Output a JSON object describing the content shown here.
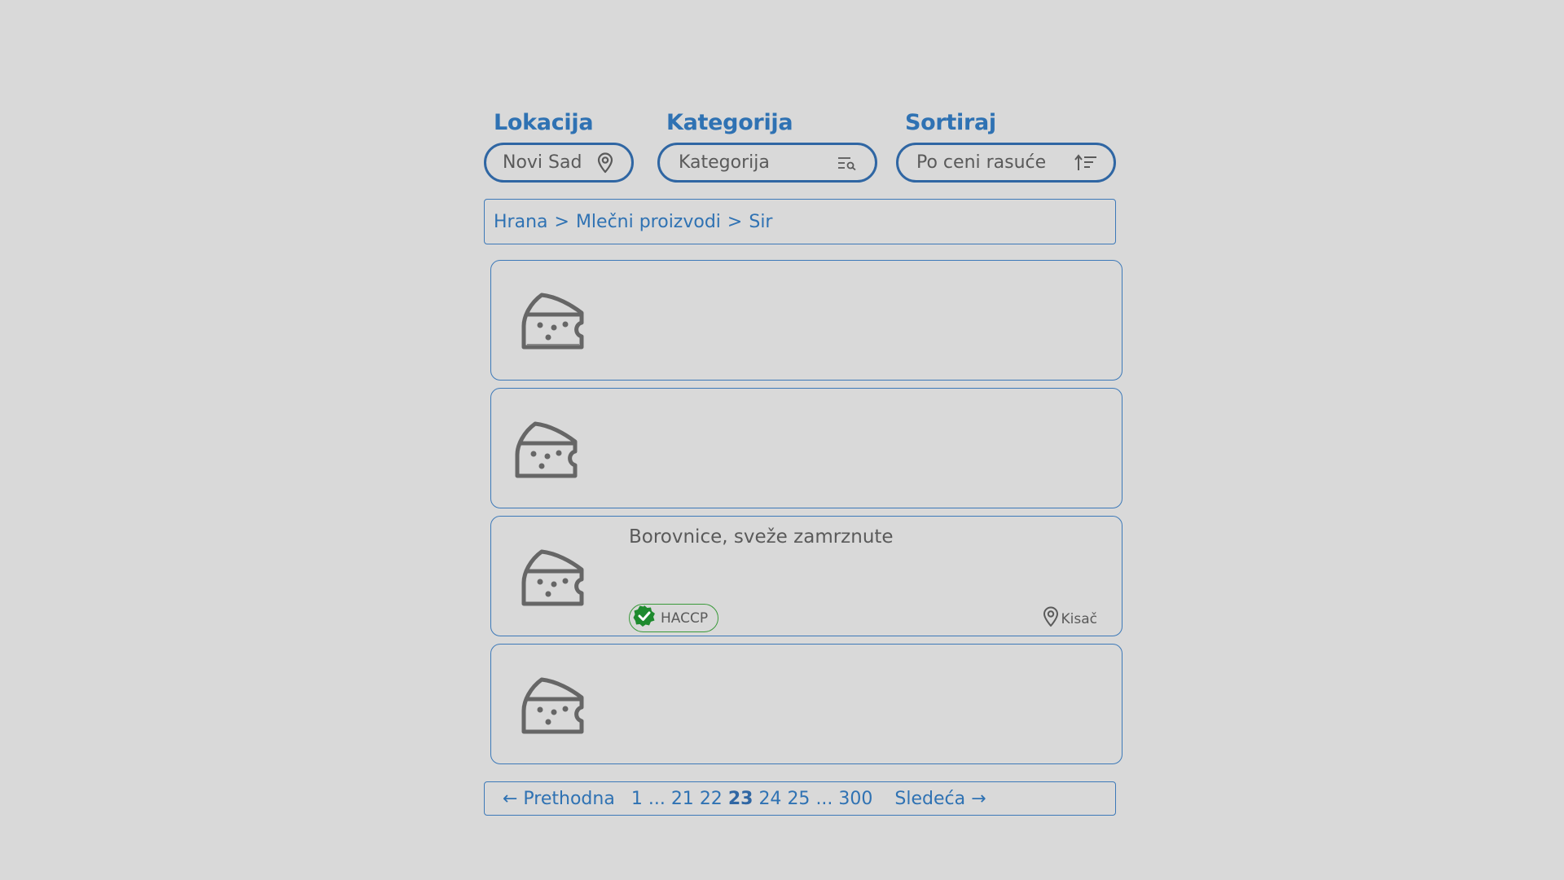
{
  "filters": {
    "location": {
      "label": "Lokacija",
      "value": "Novi Sad",
      "icon": "map-pin-icon"
    },
    "category": {
      "label": "Kategorija",
      "placeholder": "Kategorija",
      "icon": "search-list-icon"
    },
    "sort": {
      "label": "Sortiraj",
      "value": "Po ceni rasuće",
      "icon": "sort-ascending-icon"
    }
  },
  "breadcrumb": {
    "items": [
      "Hrana",
      "Mlečni proizvodi",
      "Sir"
    ],
    "separator": ">"
  },
  "listings": [
    {
      "icon": "cheese-icon",
      "title": ""
    },
    {
      "icon": "cheese-icon",
      "title": ""
    },
    {
      "icon": "cheese-icon",
      "title": "Borovnice, sveže zamrznute",
      "badge": "HACCP",
      "badge_icon": "check-badge-icon",
      "location": "Kisač",
      "location_icon": "map-pin-icon"
    },
    {
      "icon": "cheese-icon",
      "title": ""
    }
  ],
  "pagination": {
    "prev_label": "← Prethodna",
    "next_label": "Sledeća →",
    "first": "1",
    "ellipsis": "...",
    "pages": [
      "21",
      "22",
      "23",
      "24",
      "25"
    ],
    "current": "23",
    "last": "300"
  },
  "colors": {
    "accent": "#2f72b3",
    "border": "#3d79b8",
    "background": "#d9d9d9",
    "text": "#5a5a5a",
    "badge_green": "#1e8a2e"
  }
}
